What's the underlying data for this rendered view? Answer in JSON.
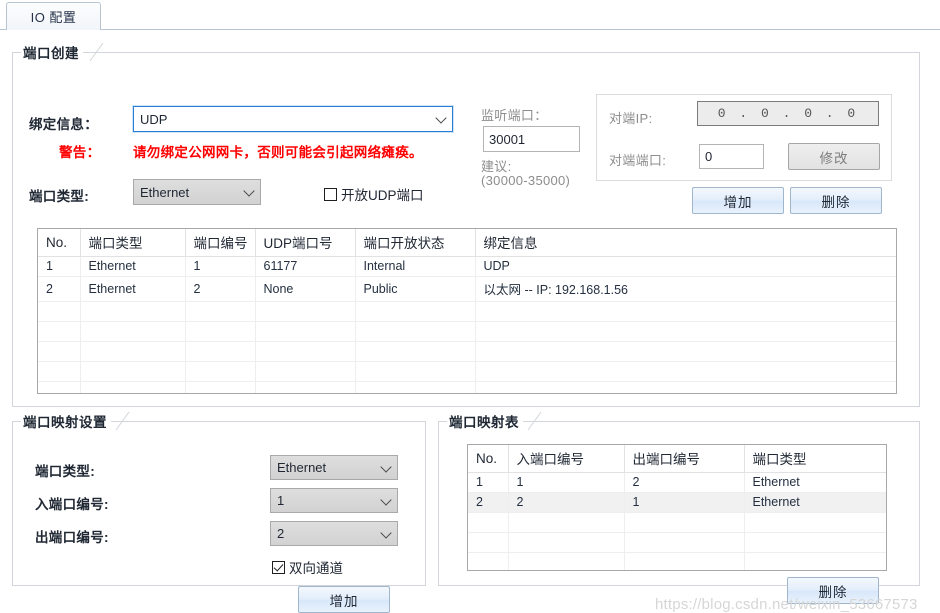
{
  "tab": {
    "label": "IO 配置"
  },
  "port_create": {
    "title": "端口创建",
    "binding_label": "绑定信息：",
    "binding_value": "UDP",
    "warn_label": "警告：",
    "warn_text": "请勿绑定公网网卡，否则可能会引起网络瘫痪。",
    "port_type_label": "端口类型:",
    "port_type_value": "Ethernet",
    "open_udp_label": "开放UDP端口",
    "open_udp_checked": false,
    "listen_port_label": "监听端口：",
    "listen_port_value": "30001",
    "listen_hint_line1": "建议:",
    "listen_hint_line2": "(30000-35000)",
    "peer_ip_label": "对端IP:",
    "peer_ip_value": "0 . 0 . 0 . 0",
    "peer_port_label": "对端端口:",
    "peer_port_value": "0",
    "modify_button": "修改",
    "add_button": "增加",
    "delete_button": "删除"
  },
  "port_table": {
    "columns": [
      "No.",
      "端口类型",
      "端口编号",
      "UDP端口号",
      "端口开放状态",
      "绑定信息"
    ],
    "rows": [
      [
        "1",
        "Ethernet",
        "1",
        "61177",
        "Internal",
        "UDP"
      ],
      [
        "2",
        "Ethernet",
        "2",
        "None",
        "Public",
        "以太网 -- IP: 192.168.1.56"
      ]
    ],
    "empty_rows": 6
  },
  "map_settings": {
    "title": "端口映射设置",
    "port_type_label": "端口类型:",
    "port_type_value": "Ethernet",
    "in_port_label": "入端口编号:",
    "in_port_value": "1",
    "out_port_label": "出端口编号:",
    "out_port_value": "2",
    "bidirectional_label": "双向通道",
    "bidirectional_checked": true,
    "add_button": "增加"
  },
  "map_table": {
    "title": "端口映射表",
    "columns": [
      "No.",
      "入端口编号",
      "出端口编号",
      "端口类型"
    ],
    "rows": [
      [
        "1",
        "1",
        "2",
        "Ethernet"
      ],
      [
        "2",
        "2",
        "1",
        "Ethernet"
      ]
    ],
    "selected_row_index": 1,
    "empty_rows": 3,
    "delete_button": "删除"
  },
  "watermark": {
    "text": "https://blog.csdn.net/weixin_53667573"
  }
}
